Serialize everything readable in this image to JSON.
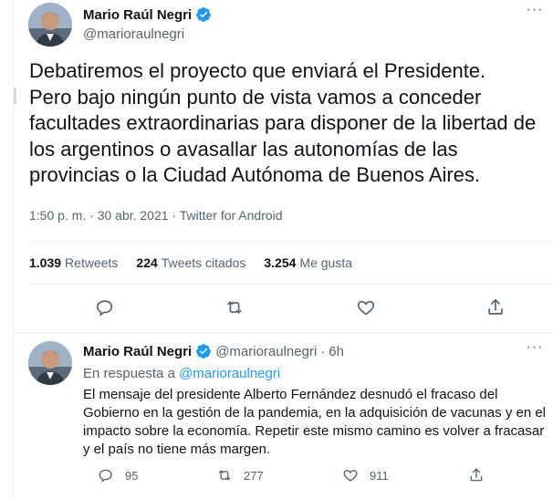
{
  "main_tweet": {
    "author_name": "Mario Raúl Negri",
    "author_handle": "@marioraulnegri",
    "text": "Debatiremos el proyecto que enviará el Presidente.\nPero bajo ningún punto de vista vamos a conceder facultades extraordinarias para disponer de la libertad de los argentinos o avasallar las autonomías de las provincias o la Ciudad Autónoma de Buenos Aires.",
    "meta": "1:50 p. m. · 30 abr. 2021 · Twitter for Android",
    "stats": {
      "retweets_count": "1.039",
      "retweets_label": "Retweets",
      "quotes_count": "224",
      "quotes_label": "Tweets citados",
      "likes_count": "3.254",
      "likes_label": "Me gusta"
    },
    "more": "···"
  },
  "reply_tweet": {
    "author_name": "Mario Raúl Negri",
    "author_handle": "@marioraulnegri",
    "separator": "·",
    "time": "6h",
    "reply_prefix": "En respuesta a",
    "reply_to_handle": "@marioraulnegri",
    "text": "El mensaje del presidente Alberto Fernández desnudó el fracaso del Gobierno en la gestión de la pandemia, en la adquisición de vacunas y en el impacto sobre la economía. Repetir este mismo camino es volver a fracasar y el país no tiene más margen.",
    "replies": "95",
    "retweets": "277",
    "likes": "911",
    "more": "···"
  },
  "colors": {
    "accent": "#1d9bf0",
    "text_primary": "#0f1419",
    "text_secondary": "#536471",
    "divider": "#eff3f4"
  },
  "icons": [
    "verified-icon",
    "reply-icon",
    "retweet-icon",
    "like-icon",
    "share-icon",
    "more-icon"
  ]
}
